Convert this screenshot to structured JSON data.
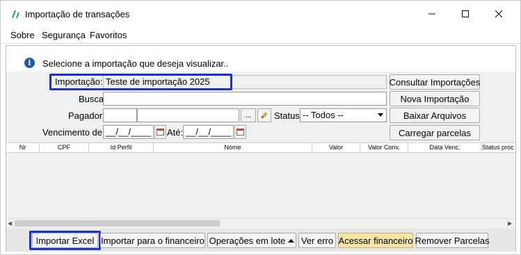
{
  "window": {
    "title": "Importação de transações"
  },
  "menu": {
    "items": [
      "Sobre",
      "Segurança",
      "Favoritos"
    ]
  },
  "info": {
    "message": "Selecione a importação que deseja visualizar.."
  },
  "form": {
    "importacao_label": "Importação:",
    "importacao_value": "Teste de importação 2025",
    "busca_label": "Busca:",
    "busca_value": "",
    "pagador_label": "Pagador:",
    "pagador_browse": "...",
    "status_label": "Status:",
    "status_value": "-- Todos --",
    "vencimento_label": "Vencimento de:",
    "vencimento_de": "__/__/____",
    "ate_label": "Até:",
    "vencimento_ate": "__/__/____"
  },
  "side_buttons": {
    "consultar": "Consultar Importações",
    "nova": "Nova Importação",
    "baixar": "Baixar Arquivos",
    "carregar": "Carregar parcelas"
  },
  "grid": {
    "columns": [
      "Nr",
      "CPF",
      "Id Perfil",
      "Nome",
      "Valor",
      "Valor Conv.",
      "Data Venc.",
      "Status proc"
    ],
    "rows": []
  },
  "bottom_buttons": {
    "importar_excel": "Importar Excel",
    "importar_financeiro": "Importar para o financeiro",
    "operacoes_lote": "Operações em lote",
    "ver_erro": "Ver erro",
    "acessar_financeiro": "Acessar financeiro",
    "remover_parcelas": "Remover Parcelas"
  },
  "colors": {
    "highlight": "#1c2fd6",
    "accent_yellow": "#f3e5a8",
    "info_blue": "#1f5aa6"
  }
}
